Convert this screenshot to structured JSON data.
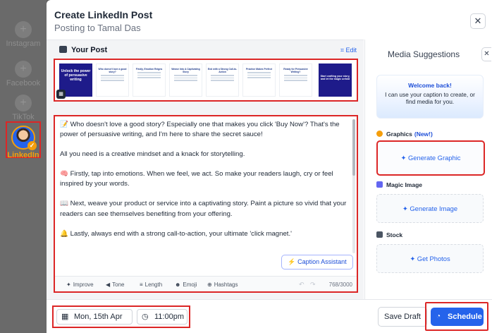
{
  "networks": [
    {
      "label": "Instagram",
      "state": "inactive"
    },
    {
      "label": "Facebook",
      "state": "inactive"
    },
    {
      "label": "TikTok",
      "state": "inactive"
    },
    {
      "label": "LinkedIn",
      "state": "selected"
    }
  ],
  "header": {
    "title": "Create LinkedIn Post",
    "subtitle": "Posting to Tamal Das"
  },
  "your_post": {
    "label": "Your Post",
    "edit_label": "Edit"
  },
  "carousel": {
    "slides": [
      {
        "title": "Unlock the power of persuasive writing",
        "style": "dark"
      },
      {
        "title": "Who doesn't love a good story?",
        "style": "light"
      },
      {
        "title": "Firstly, Emotion Reigns",
        "style": "light"
      },
      {
        "title": "Weave Into A Captivating Story",
        "style": "light"
      },
      {
        "title": "End with a Strong Call-to-Action",
        "style": "light"
      },
      {
        "title": "Practice Makes Perfect",
        "style": "light"
      },
      {
        "title": "Ready for Persuasive Writing?",
        "style": "light"
      },
      {
        "title": "Start crafting your story, and let the magic unfold",
        "style": "dark"
      }
    ]
  },
  "post": {
    "paragraphs": [
      "📝 Who doesn't love a good story? Especially one that makes you click 'Buy Now'? That's the power of persuasive writing, and I'm here to share the secret sauce!",
      "All you need is a creative mindset and a knack for storytelling.",
      "🧠 Firstly, tap into emotions. When we feel, we act. So make your readers laugh, cry or feel inspired by your words.",
      "📖 Next, weave your product or service into a captivating story. Paint a picture so vivid that your readers can see themselves benefiting from your offering.",
      "🔔 Lastly, always end with a strong call-to-action, your ultimate 'click magnet.'"
    ],
    "caption_assistant_label": "Caption Assistant",
    "char_count": "768/3000"
  },
  "toolbar": {
    "improve": "Improve",
    "tone": "Tone",
    "length": "Length",
    "emoji": "Emoji",
    "hashtags": "Hashtags"
  },
  "media": {
    "title": "Media Suggestions",
    "welcome_title": "Welcome back!",
    "welcome_text": "I can use your caption to create, or find media for you.",
    "graphics_label": "Graphics",
    "graphics_new": "(New!)",
    "generate_graphic": "Generate Graphic",
    "magic_label": "Magic Image",
    "generate_image": "Generate Image",
    "stock_label": "Stock",
    "get_photos": "Get Photos"
  },
  "footer": {
    "date": "Mon, 15th Apr",
    "time": "11:00pm",
    "save_draft": "Save Draft",
    "schedule": "Schedule"
  },
  "colors": {
    "accent": "#2563eb",
    "highlight": "#dc2626",
    "linkedin_selected": "#f59e0b"
  }
}
